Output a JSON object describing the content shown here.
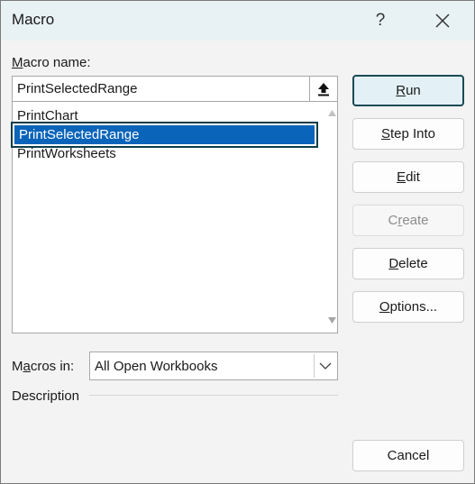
{
  "window": {
    "title": "Macro",
    "help": "?"
  },
  "macro_name": {
    "label_underlined": "M",
    "label_rest": "acro name:",
    "value": "PrintSelectedRange"
  },
  "macro_list": [
    {
      "name": "PrintChart",
      "selected": false
    },
    {
      "name": "PrintSelectedRange",
      "selected": true
    },
    {
      "name": "PrintWorksheets",
      "selected": false
    }
  ],
  "buttons": {
    "run": {
      "underlined": "R",
      "rest": "un"
    },
    "step_into": {
      "underlined": "S",
      "rest": "tep Into"
    },
    "edit": {
      "underlined": "E",
      "rest": "dit"
    },
    "create": {
      "before": "C",
      "underlined": "r",
      "rest": "eate"
    },
    "delete": {
      "underlined": "D",
      "rest": "elete"
    },
    "options": {
      "underlined": "O",
      "rest": "ptions..."
    },
    "cancel": "Cancel"
  },
  "macros_in": {
    "label_before": "M",
    "label_underlined": "a",
    "label_rest": "cros in:",
    "value": "All Open Workbooks"
  },
  "description": {
    "label": "Description"
  },
  "colors": {
    "selection": "#0a64ba",
    "primary_border": "#1b4a56",
    "titlebar": "#e8f1f4"
  }
}
